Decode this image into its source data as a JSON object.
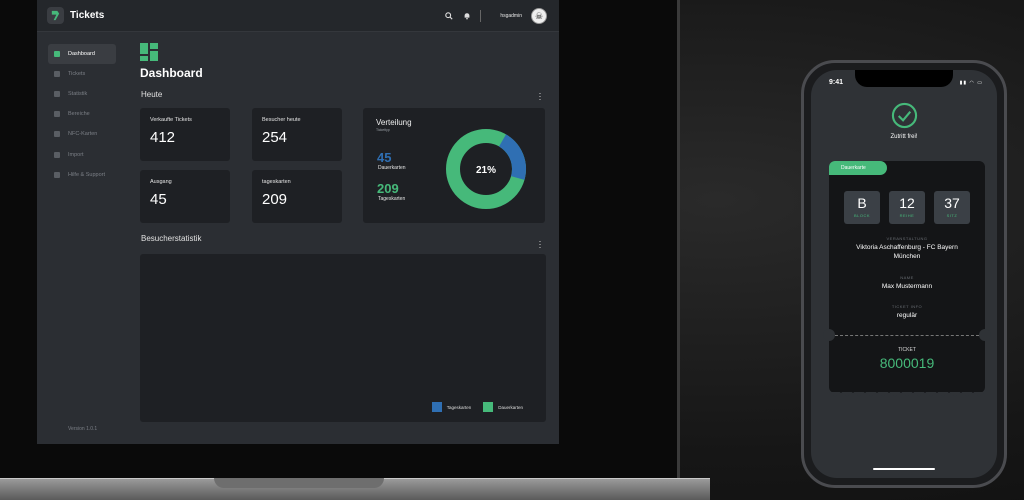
{
  "app": {
    "title": "Tickets",
    "username": "hsgadmin",
    "version": "Version 1.0.1"
  },
  "sidebar": {
    "items": [
      {
        "label": "Dashboard",
        "icon": "dashboard-icon",
        "active": true
      },
      {
        "label": "Tickets",
        "icon": "ticket-icon"
      },
      {
        "label": "Statistik",
        "icon": "chart-icon"
      },
      {
        "label": "Bereiche",
        "icon": "area-icon"
      },
      {
        "label": "NFC-Karten",
        "icon": "card-icon"
      },
      {
        "label": "Import",
        "icon": "import-icon"
      },
      {
        "label": "Hilfe & Support",
        "icon": "help-icon"
      }
    ]
  },
  "page": {
    "title": "Dashboard"
  },
  "today": {
    "title": "Heute",
    "stats": [
      {
        "label": "Verkaufte Tickets",
        "value": "412"
      },
      {
        "label": "Besucher heute",
        "value": "254"
      },
      {
        "label": "Ausgang",
        "value": "45"
      },
      {
        "label": "tageskarten",
        "value": "209"
      }
    ]
  },
  "distribution": {
    "title": "Verteilung",
    "subtitle": "Tickettyp",
    "items": [
      {
        "value": "45",
        "label": "Dauerkarten",
        "color": "#2f6fb3"
      },
      {
        "value": "209",
        "label": "Tageskarten",
        "color": "#46b97a"
      }
    ],
    "center_label": "21%",
    "dauer_fraction": 0.21
  },
  "visitor_stats": {
    "title": "Besucherstatistik",
    "legend": [
      {
        "label": "Tageskarten",
        "color": "#2f6fb3"
      },
      {
        "label": "Dauerkarten",
        "color": "#46b97a"
      }
    ]
  },
  "phone": {
    "time": "9:41",
    "status": "Zutritt frei!",
    "ticket": {
      "tag": "Dauerkarte",
      "seats": [
        {
          "value": "B",
          "label": "BLOCK"
        },
        {
          "value": "12",
          "label": "REIHE"
        },
        {
          "value": "37",
          "label": "SITZ"
        }
      ],
      "event_label": "VERANSTALTUNG",
      "event_line1": "Viktoria Aschaffenburg - FC Bayern",
      "event_line2": "München",
      "name_label": "NAME",
      "name": "Max Mustermann",
      "info_label": "TICKET INFO",
      "info": "regulär",
      "number_label": "TICKET",
      "number": "8000019"
    }
  },
  "colors": {
    "accent": "#46b97a",
    "secondary": "#2f6fb3"
  }
}
